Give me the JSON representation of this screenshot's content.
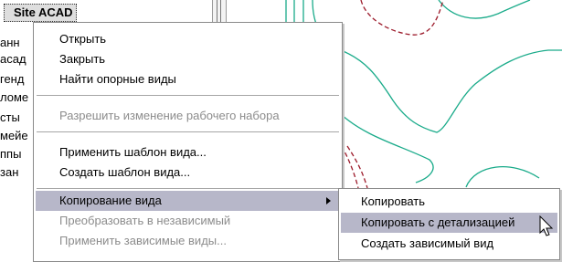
{
  "tree": {
    "title": "Site ACAD",
    "rows": [
      "анн",
      "асад",
      "генд",
      "ломе",
      "сты",
      "мейе",
      "ппы",
      "зан"
    ]
  },
  "context_menu": {
    "items": [
      {
        "label": "Открыть",
        "enabled": true
      },
      {
        "label": "Закрыть",
        "enabled": true
      },
      {
        "label": "Найти опорные виды",
        "enabled": true
      },
      {
        "label": "Разрешить изменение рабочего набора",
        "enabled": false
      },
      {
        "label": "Применить шаблон вида...",
        "enabled": true
      },
      {
        "label": "Создать шаблон вида...",
        "enabled": true
      },
      {
        "label": "Копирование вида",
        "enabled": true,
        "submenu": true,
        "highlighted": true
      },
      {
        "label": "Преобразовать в независимый",
        "enabled": false
      },
      {
        "label": "Применить зависимые виды...",
        "enabled": false
      }
    ]
  },
  "submenu": {
    "items": [
      {
        "label": "Копировать"
      },
      {
        "label": "Копировать с детализацией",
        "highlighted": true
      },
      {
        "label": "Создать зависимый вид"
      }
    ]
  },
  "colors": {
    "contour": "#1aab8a",
    "dashed": "#9c1a2a",
    "menu_highlight": "#b7b7c9"
  }
}
